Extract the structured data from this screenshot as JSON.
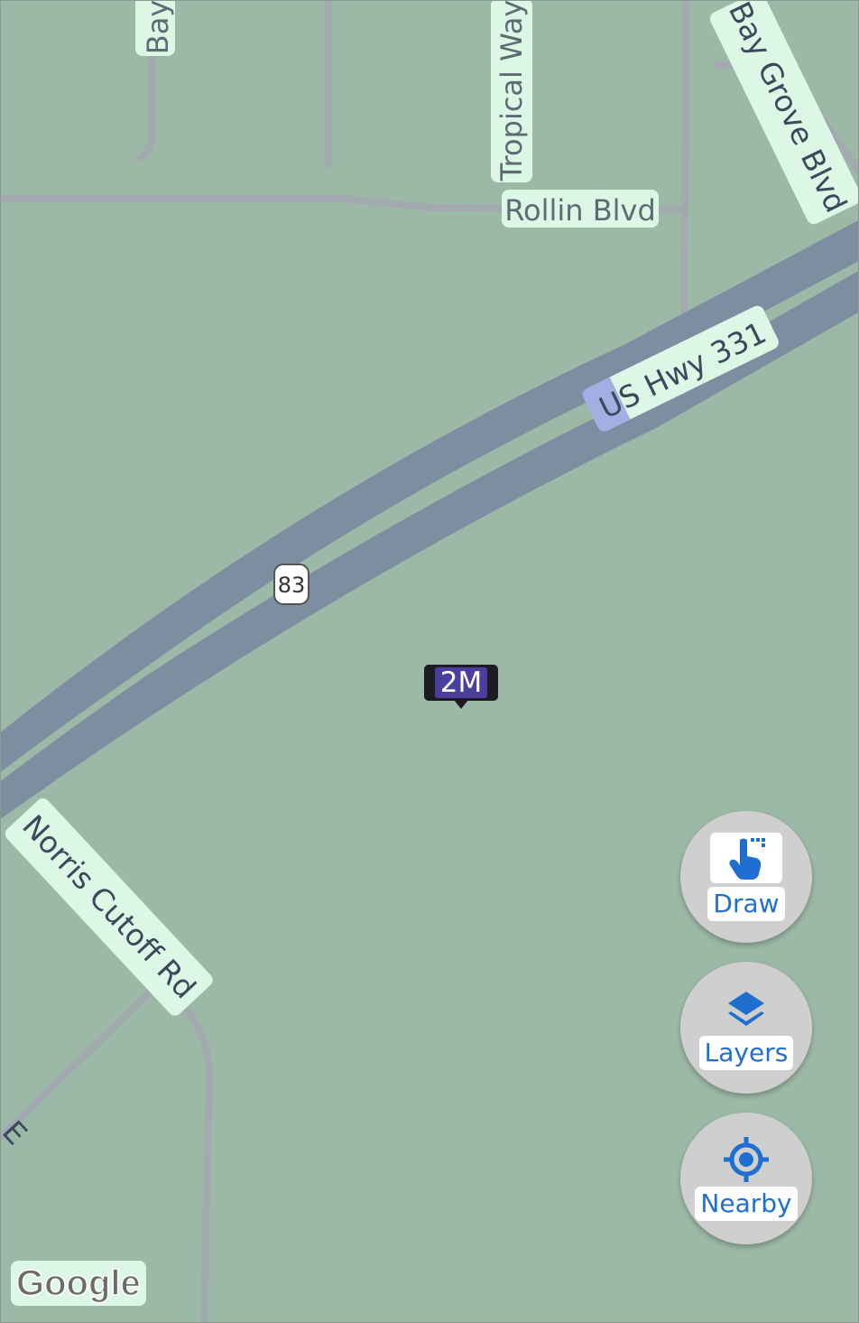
{
  "map": {
    "attribution": "Google",
    "background_color": "#9cb8a6",
    "streets": {
      "top_left": "Bay",
      "tropical": "Tropical Way",
      "bay_grove": "Bay Grove Blvd",
      "rollin": "Rollin Blvd",
      "highway": "US Hwy 331",
      "norris": "Norris Cutoff Rd",
      "cutoff_edge": "E"
    },
    "route_shield": "83",
    "marker": {
      "label": "2M"
    }
  },
  "controls": {
    "draw": {
      "label": "Draw",
      "icon": "hand-pointer-icon"
    },
    "layers": {
      "label": "Layers",
      "icon": "layers-icon"
    },
    "nearby": {
      "label": "Nearby",
      "icon": "location-target-icon"
    }
  },
  "colors": {
    "accent": "#1f6fd1",
    "marker_bg": "#1c1c22",
    "marker_fill": "#4b3f9e",
    "highway": "#7d8ea0",
    "road": "#a2aab0",
    "label_bg": "#dcf7e6"
  }
}
